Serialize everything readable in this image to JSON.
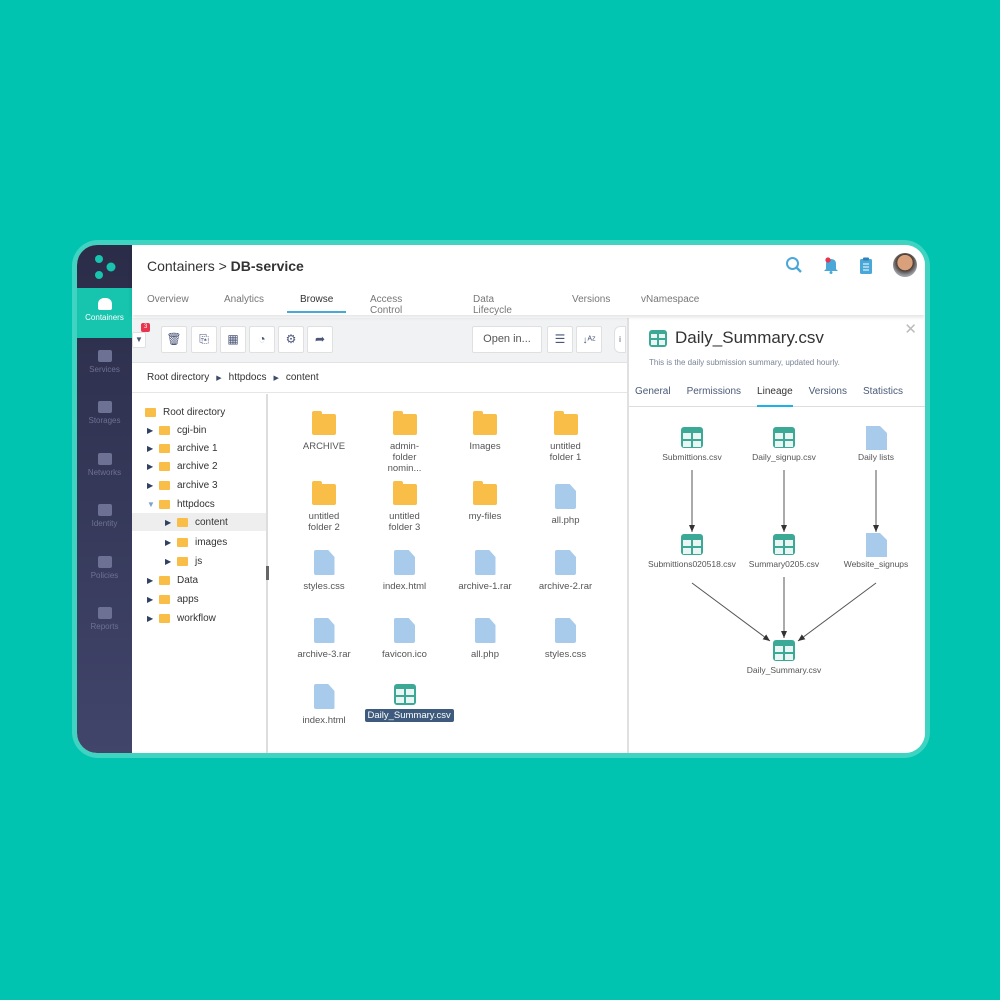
{
  "colors": {
    "background": "#00c4b0",
    "accent": "#17c4ae",
    "sidebar": "#2a2c48",
    "folder": "#f8be48",
    "file": "#a9cbeb",
    "csv": "#3ca896",
    "badge": "#e8344f"
  },
  "sidebar": {
    "items": [
      {
        "label": "Containers",
        "icon": "container-icon",
        "active": true
      },
      {
        "label": "Services",
        "icon": "checkbox-icon"
      },
      {
        "label": "Storages",
        "icon": "database-icon"
      },
      {
        "label": "Networks",
        "icon": "network-icon"
      },
      {
        "label": "Identity",
        "icon": "id-card-icon"
      },
      {
        "label": "Policies",
        "icon": "book-icon"
      },
      {
        "label": "Reports",
        "icon": "pie-chart-icon"
      }
    ]
  },
  "header": {
    "crumb_parent": "Containers",
    "crumb_sep": ">",
    "crumb_current": "DB-service",
    "tabs": [
      "Overview",
      "Analytics",
      "Browse",
      "Access Control",
      "Data Lifecycle",
      "Versions",
      "vNamespace"
    ],
    "active_tab": "Browse"
  },
  "toolbar": {
    "filter_count": "3",
    "open_in": "Open in..."
  },
  "breadcrumb": [
    "Root directory",
    "httpdocs",
    "content"
  ],
  "tree": [
    {
      "label": "Root directory",
      "level": 0,
      "arrow": ""
    },
    {
      "label": "cgi-bin",
      "level": 1,
      "arrow": "▶"
    },
    {
      "label": "archive 1",
      "level": 1,
      "arrow": "▶"
    },
    {
      "label": "archive 2",
      "level": 1,
      "arrow": "▶"
    },
    {
      "label": "archive 3",
      "level": 1,
      "arrow": "▶"
    },
    {
      "label": "httpdocs",
      "level": 1,
      "arrow": "▼"
    },
    {
      "label": "content",
      "level": 2,
      "arrow": "▶",
      "selected": true
    },
    {
      "label": "images",
      "level": 2,
      "arrow": "▶"
    },
    {
      "label": "js",
      "level": 2,
      "arrow": "▶"
    },
    {
      "label": "Data",
      "level": 1,
      "arrow": "▶"
    },
    {
      "label": "apps",
      "level": 1,
      "arrow": "▶"
    },
    {
      "label": "workflow",
      "level": 1,
      "arrow": "▶"
    }
  ],
  "files": [
    {
      "name": "ARCHIVE",
      "type": "folder"
    },
    {
      "name": "admin-folder nomin...",
      "type": "folder"
    },
    {
      "name": "Images",
      "type": "folder"
    },
    {
      "name": "untitled folder 1",
      "type": "folder"
    },
    {
      "name": "untitled folder 2",
      "type": "folder"
    },
    {
      "name": "untitled folder 3",
      "type": "folder"
    },
    {
      "name": "my-files",
      "type": "folder"
    },
    {
      "name": "all.php",
      "type": "file"
    },
    {
      "name": "styles.css",
      "type": "file"
    },
    {
      "name": "index.html",
      "type": "file"
    },
    {
      "name": "archive-1.rar",
      "type": "file"
    },
    {
      "name": "archive-2.rar",
      "type": "file"
    },
    {
      "name": "archive-3.rar",
      "type": "file"
    },
    {
      "name": "favicon.ico",
      "type": "file"
    },
    {
      "name": "all.php",
      "type": "file"
    },
    {
      "name": "styles.css",
      "type": "file"
    },
    {
      "name": "index.html",
      "type": "file"
    },
    {
      "name": "Daily_Summary.csv",
      "type": "csv",
      "selected": true
    }
  ],
  "panel": {
    "title": "Daily_Summary.csv",
    "description": "This is the daily submission summary, updated hourly.",
    "tabs": [
      "General",
      "Permissions",
      "Lineage",
      "Versions",
      "Statistics"
    ],
    "active_tab": "Lineage",
    "lineage": {
      "nodes": [
        {
          "label": "Submittions.csv",
          "type": "csv"
        },
        {
          "label": "Daily_signup.csv",
          "type": "csv"
        },
        {
          "label": "Daily lists",
          "type": "file"
        },
        {
          "label": "Submittions020518.csv",
          "type": "csv"
        },
        {
          "label": "Summary0205.csv",
          "type": "csv"
        },
        {
          "label": "Website_signups",
          "type": "file"
        },
        {
          "label": "Daily_Summary.csv",
          "type": "csv"
        }
      ],
      "edges": [
        [
          0,
          3
        ],
        [
          1,
          4
        ],
        [
          2,
          5
        ],
        [
          3,
          6
        ],
        [
          4,
          6
        ],
        [
          5,
          6
        ]
      ]
    }
  }
}
